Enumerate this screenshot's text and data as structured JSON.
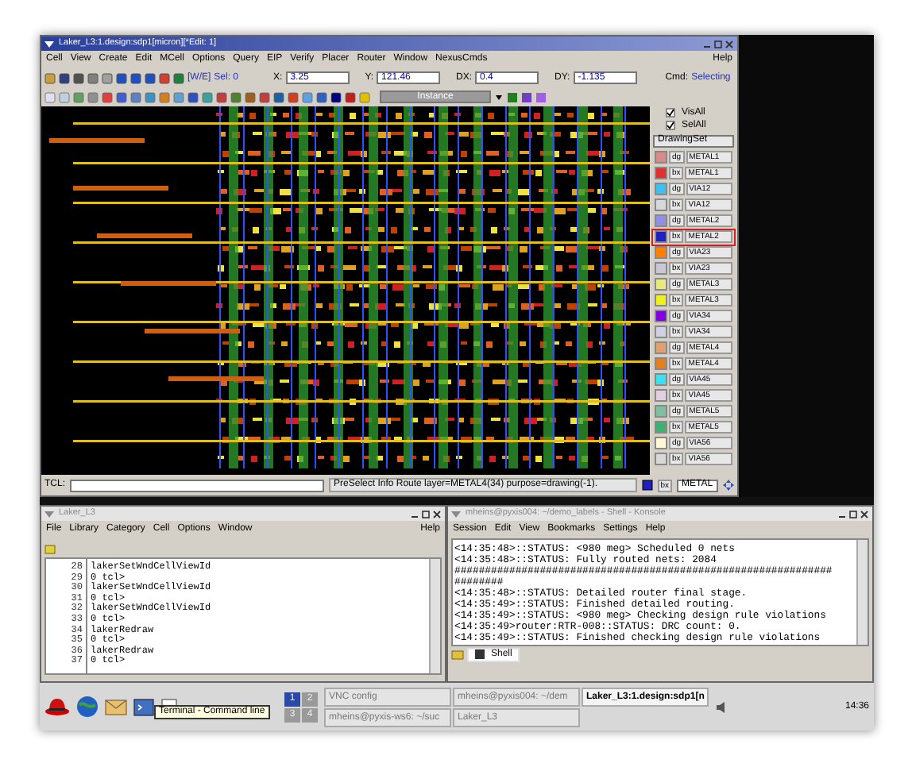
{
  "layout_window": {
    "title": "Laker_L3:1.design:sdp1[micron][*Edit: 1]",
    "menus": [
      "Cell",
      "View",
      "Create",
      "Edit",
      "MCell",
      "Options",
      "Query",
      "EIP",
      "Verify",
      "Placer",
      "Router",
      "Window",
      "NexusCmds"
    ],
    "help": "Help",
    "coords": {
      "mode": "[W/E]",
      "sel": "Sel: 0",
      "fields": [
        {
          "label": "X:",
          "value": "3.25"
        },
        {
          "label": "Y:",
          "value": "121.46"
        },
        {
          "label": "DX:",
          "value": "0.4"
        },
        {
          "label": "DY:",
          "value": "-1.135"
        }
      ],
      "cmd_label": "Cmd:",
      "cmd": "Selecting"
    },
    "instance_dropdown": "Instance",
    "visibility": [
      {
        "label": "VisAll",
        "checked": true
      },
      {
        "label": "SelAll",
        "checked": true
      }
    ],
    "drawing_set": "DrawingSet",
    "layers": [
      {
        "purpose": "dg",
        "name": "METAL1",
        "color": "#d98a8a",
        "selected": false
      },
      {
        "purpose": "bx",
        "name": "METAL1",
        "color": "#e03030",
        "selected": false
      },
      {
        "purpose": "dg",
        "name": "VIA12",
        "color": "#40c0f0",
        "selected": false
      },
      {
        "purpose": "bx",
        "name": "VIA12",
        "color": "#d8d8d8",
        "selected": false
      },
      {
        "purpose": "dg",
        "name": "METAL2",
        "color": "#9090e0",
        "selected": false
      },
      {
        "purpose": "bx",
        "name": "METAL2",
        "color": "#2020c0",
        "selected": true
      },
      {
        "purpose": "dg",
        "name": "VIA23",
        "color": "#ff8000",
        "selected": false
      },
      {
        "purpose": "bx",
        "name": "VIA23",
        "color": "#c8c8d8",
        "selected": false
      },
      {
        "purpose": "dg",
        "name": "METAL3",
        "color": "#e8e880",
        "selected": false
      },
      {
        "purpose": "bx",
        "name": "METAL3",
        "color": "#f0f020",
        "selected": false
      },
      {
        "purpose": "dg",
        "name": "VIA34",
        "color": "#8000e0",
        "selected": false
      },
      {
        "purpose": "bx",
        "name": "VIA34",
        "color": "#d0d0e0",
        "selected": false
      },
      {
        "purpose": "dg",
        "name": "METAL4",
        "color": "#e0a070",
        "selected": false
      },
      {
        "purpose": "bx",
        "name": "METAL4",
        "color": "#e08020",
        "selected": false
      },
      {
        "purpose": "dg",
        "name": "VIA45",
        "color": "#40e0f0",
        "selected": false
      },
      {
        "purpose": "bx",
        "name": "VIA45",
        "color": "#e0d0e0",
        "selected": false
      },
      {
        "purpose": "dg",
        "name": "METAL5",
        "color": "#80c0a0",
        "selected": false
      },
      {
        "purpose": "bx",
        "name": "METAL5",
        "color": "#40b070",
        "selected": false
      },
      {
        "purpose": "dg",
        "name": "VIA56",
        "color": "#fff8d0",
        "selected": false
      },
      {
        "purpose": "bx",
        "name": "VIA56",
        "color": "#d8d8d8",
        "selected": false
      }
    ],
    "status": {
      "tcl_label": "TCL:",
      "info": "PreSelect Info Route layer=METAL4(34) purpose=drawing(-1).",
      "layer_purpose": "bx",
      "layer_field": "METAL"
    }
  },
  "tcl_window": {
    "title": "Laker_L3",
    "menus": [
      "File",
      "Library",
      "Category",
      "Cell",
      "Options",
      "Window"
    ],
    "help": "Help",
    "lines": [
      {
        "number": "28",
        "text": "lakerSetWndCellViewId"
      },
      {
        "number": "29",
        "text": "0 tcl>"
      },
      {
        "number": "30",
        "text": "lakerSetWndCellViewId"
      },
      {
        "number": "31",
        "text": "0 tcl>"
      },
      {
        "number": "32",
        "text": "lakerSetWndCellViewId"
      },
      {
        "number": "33",
        "text": "0 tcl>"
      },
      {
        "number": "34",
        "text": "lakerRedraw"
      },
      {
        "number": "35",
        "text": "0 tcl>"
      },
      {
        "number": "36",
        "text": "lakerRedraw"
      },
      {
        "number": "37",
        "text": "0 tcl>"
      }
    ]
  },
  "konsole": {
    "title": "mheins@pyxis004: ~/demo_labels - Shell - Konsole",
    "menus": [
      "Session",
      "Edit",
      "View",
      "Bookmarks",
      "Settings",
      "Help"
    ],
    "lines": [
      "<14:35:48>::STATUS: <980 meg> Scheduled 0 nets",
      "<14:35:48>::STATUS: Fully routed nets: 2084",
      "##############################################################",
      "########",
      "<14:35:48>::STATUS: Detailed router final stage.",
      "<14:35:49>::STATUS: Finished detailed routing.",
      "<14:35:49>::STATUS: <980 meg> Checking design rule violations",
      "<14:35:49>router:RTR-008::STATUS: DRC count: 0.",
      "<14:35:49>::STATUS: Finished checking design rule violations"
    ],
    "tab": "Shell"
  },
  "taskbar": {
    "tooltip": "Terminal - Command line",
    "pager": [
      {
        "label": "1",
        "selected": true
      },
      {
        "label": "2",
        "selected": false
      },
      {
        "label": "3",
        "selected": false
      },
      {
        "label": "4",
        "selected": false
      }
    ],
    "tasks": [
      {
        "label": "VNC config",
        "selected": false
      },
      {
        "label": "mheins@pyxis004: ~/dem",
        "selected": false
      },
      {
        "label": "Laker_L3:1.design:sdp1[n",
        "selected": true
      },
      {
        "label": "mheins@pyxis-ws6: ~/suc",
        "selected": false
      },
      {
        "label": "Laker_L3",
        "selected": false
      }
    ],
    "clock": "14:36"
  }
}
